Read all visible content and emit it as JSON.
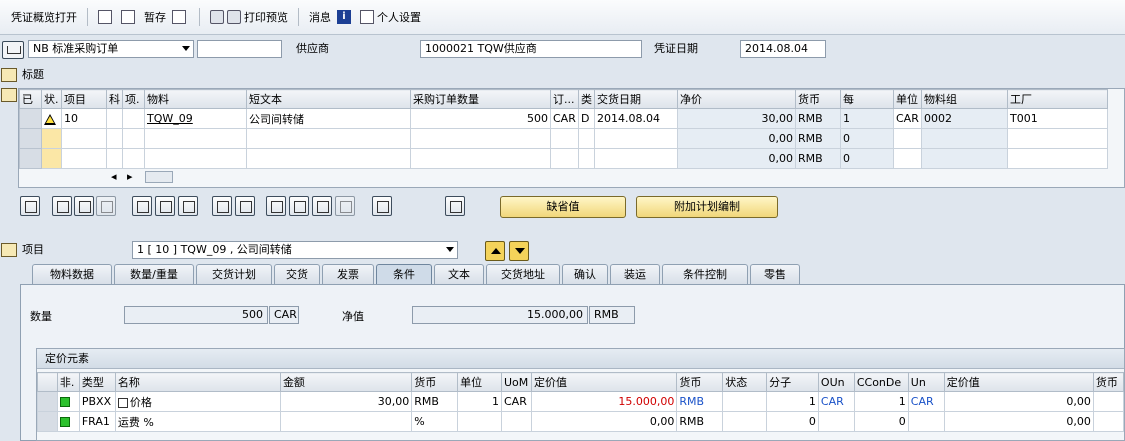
{
  "toolbar": {
    "items": [
      "凭证概览打开",
      "暂存",
      "打印预览",
      "消息",
      "个人设置"
    ]
  },
  "header": {
    "doc_type": "NB 标准采购订单",
    "doc_number": "",
    "vendor_label": "供应商",
    "vendor_value": "1000021 TQW供应商",
    "date_label": "凭证日期",
    "date_value": "2014.08.04"
  },
  "sections": {
    "header_title": "标题"
  },
  "items_table": {
    "columns": [
      "已",
      "状.",
      "项目",
      "科",
      "项.",
      "物料",
      "短文本",
      "采购订单数量",
      "订...",
      "类",
      "交货日期",
      "净价",
      "货币",
      "每",
      "单位",
      "物料组",
      "工厂"
    ],
    "rows": [
      {
        "item": "10",
        "material": "TQW_09",
        "text": "公司间转储",
        "qty": "500",
        "uom": "CAR",
        "cat": "D",
        "date": "2014.08.04",
        "price": "30,00",
        "currency": "RMB",
        "per": "1",
        "unit": "CAR",
        "group": "0002",
        "plant": "T001"
      },
      {
        "item": "",
        "material": "",
        "text": "",
        "qty": "",
        "uom": "",
        "cat": "",
        "date": "",
        "price": "0,00",
        "currency": "RMB",
        "per": "0",
        "unit": "",
        "group": "",
        "plant": ""
      },
      {
        "item": "",
        "material": "",
        "text": "",
        "qty": "",
        "uom": "",
        "cat": "",
        "date": "",
        "price": "0,00",
        "currency": "RMB",
        "per": "0",
        "unit": "",
        "group": "",
        "plant": ""
      }
    ]
  },
  "buttons": {
    "default_values": "缺省值",
    "additional_planning": "附加计划编制"
  },
  "item_selector": {
    "label": "项目",
    "value": "1 [ 10 ] TQW_09 , 公司间转储"
  },
  "tabs": [
    "物料数据",
    "数量/重量",
    "交货计划",
    "交货",
    "发票",
    "条件",
    "文本",
    "交货地址",
    "确认",
    "装运",
    "条件控制",
    "零售"
  ],
  "active_tab": "条件",
  "conditions": {
    "qty_label": "数量",
    "qty_value": "500",
    "qty_unit": "CAR",
    "net_label": "净值",
    "net_value": "15.000,00",
    "net_currency": "RMB"
  },
  "pricing": {
    "title": "定价元素",
    "columns": [
      "非.",
      "类型",
      "名称",
      "金额",
      "货币",
      "单位",
      "UoM",
      "定价值",
      "货币",
      "状态",
      "分子",
      "OUn",
      "CConDe",
      "Un",
      "定价值",
      "货币"
    ],
    "rows": [
      {
        "type": "PBXX",
        "name": "价格",
        "amount": "30,00",
        "currency": "RMB",
        "unit": "1",
        "uom": "CAR",
        "value": "15.000,00",
        "vcurrency": "RMB",
        "num": "1",
        "oun": "CAR",
        "ccon": "1",
        "un": "CAR",
        "value2": "0,00"
      },
      {
        "type": "FRA1",
        "name": "运费 %",
        "amount": "",
        "currency": "%",
        "unit": "",
        "uom": "",
        "value": "0,00",
        "vcurrency": "RMB",
        "num": "0",
        "oun": "",
        "ccon": "0",
        "un": "",
        "value2": "0,00"
      }
    ]
  }
}
